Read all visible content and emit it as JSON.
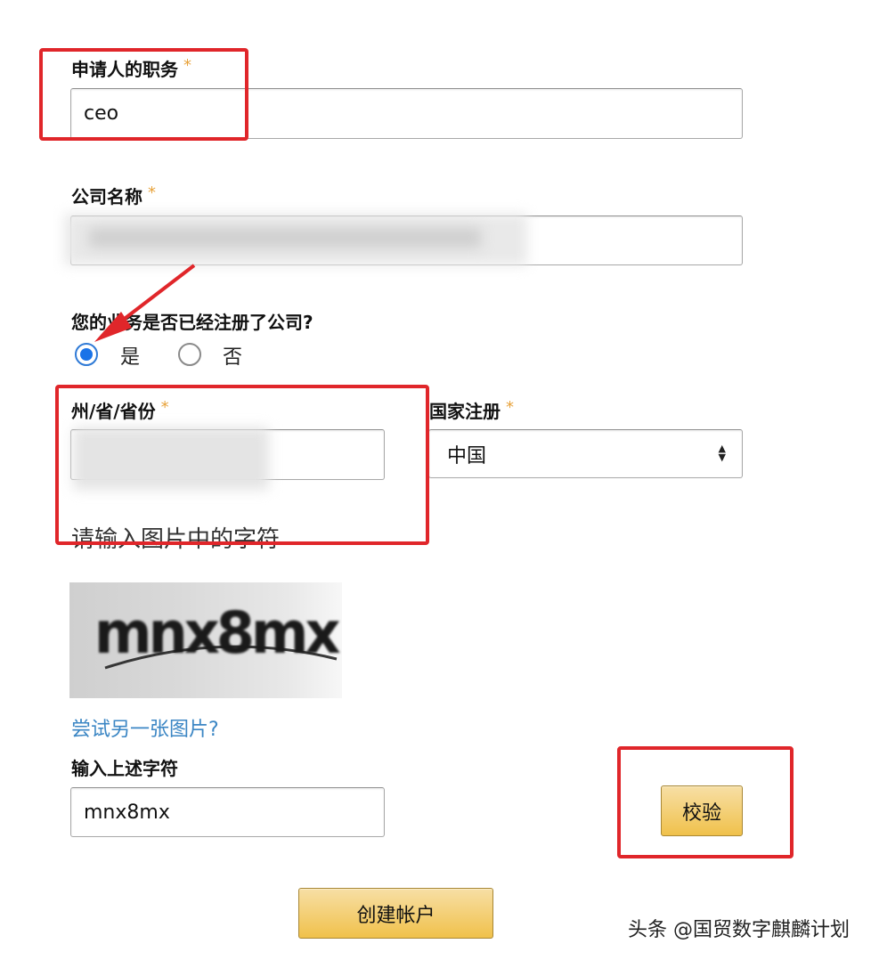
{
  "form": {
    "applicant_title": {
      "label": "申请人的职务",
      "required_mark": "*",
      "value": "ceo"
    },
    "company_name": {
      "label": "公司名称",
      "required_mark": "*",
      "value": ""
    },
    "registered_question": {
      "label": "您的业务是否已经注册了公司?",
      "options": [
        {
          "label": "是",
          "selected": true
        },
        {
          "label": "否",
          "selected": false
        }
      ]
    },
    "state_province": {
      "label": "州/省/省份",
      "required_mark": "*",
      "value": ""
    },
    "country": {
      "label": "国家注册",
      "required_mark": "*",
      "value": "中国"
    },
    "captcha": {
      "prompt": "请输入图片中的字符",
      "image_text": "mnx8mx",
      "try_another": "尝试另一张图片?",
      "input_label": "输入上述字符",
      "input_value": "mnx8mx",
      "verify_button": "校验"
    },
    "submit_button": "创建帐户"
  },
  "watermark": "头条 @国贸数字麒麟计划",
  "colors": {
    "annotation_red": "#e0262a",
    "required_mark": "#e8a33c",
    "link_blue": "#3b86c4",
    "radio_blue": "#1a73e8",
    "button_gold": "#f0c14b"
  }
}
